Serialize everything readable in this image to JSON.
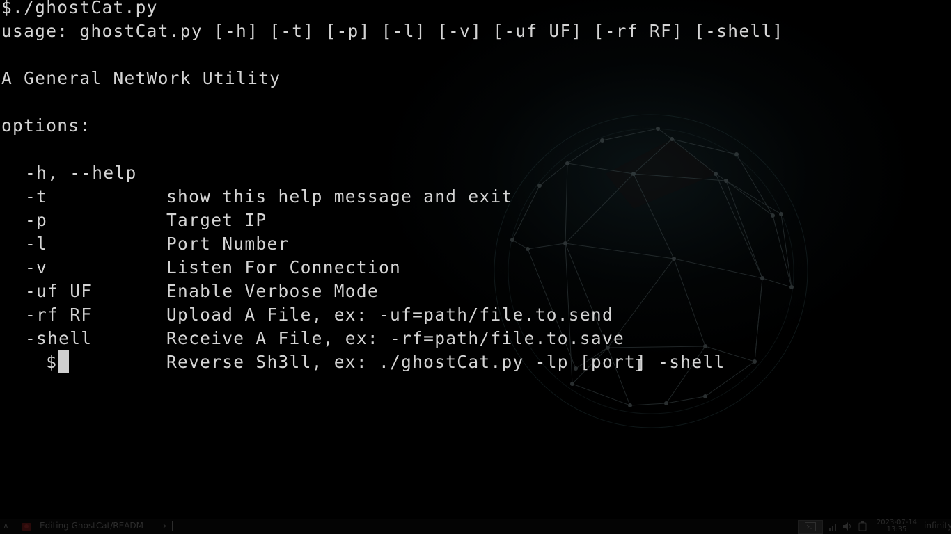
{
  "terminal": {
    "lines": {
      "command": "$./ghostCat.py",
      "usage": "usage: ghostCat.py [-h] [-t] [-p] [-l] [-v] [-uf UF] [-rf RF] [-shell]",
      "description": "A General NetWork Utility",
      "options_header": "options:"
    },
    "options": [
      {
        "flag": "-h, --help",
        "desc": "show this help message and exit"
      },
      {
        "flag": "-t",
        "desc": "Target IP"
      },
      {
        "flag": "-p",
        "desc": "Port Number"
      },
      {
        "flag": "-l",
        "desc": "Listen For Connection"
      },
      {
        "flag": "-v",
        "desc": "Enable Verbose Mode"
      },
      {
        "flag": "-uf UF",
        "desc": "Upload A File, ex: -uf=path/file.to.send"
      },
      {
        "flag": "-rf RF",
        "desc": "Receive A File, ex: -rf=path/file.to.save"
      },
      {
        "flag": "-shell",
        "desc": "Reverse Sh3ll, ex: ./ghostCat.py -lp [port] -shell"
      }
    ],
    "prompt": "$",
    "colors": {
      "text": "#d4d4d4",
      "background": "#000000",
      "cursor": "#cfcfcf"
    }
  },
  "taskbar": {
    "menu_glyph": "∧",
    "app_title": "Editing GhostCat/READM",
    "clock_date": "2023-07-14",
    "clock_time": "13:35",
    "user": "infinity",
    "icons": [
      "app-menu-icon",
      "editor-app-icon",
      "terminal-icon",
      "network-icon",
      "volume-icon",
      "battery-icon"
    ]
  }
}
